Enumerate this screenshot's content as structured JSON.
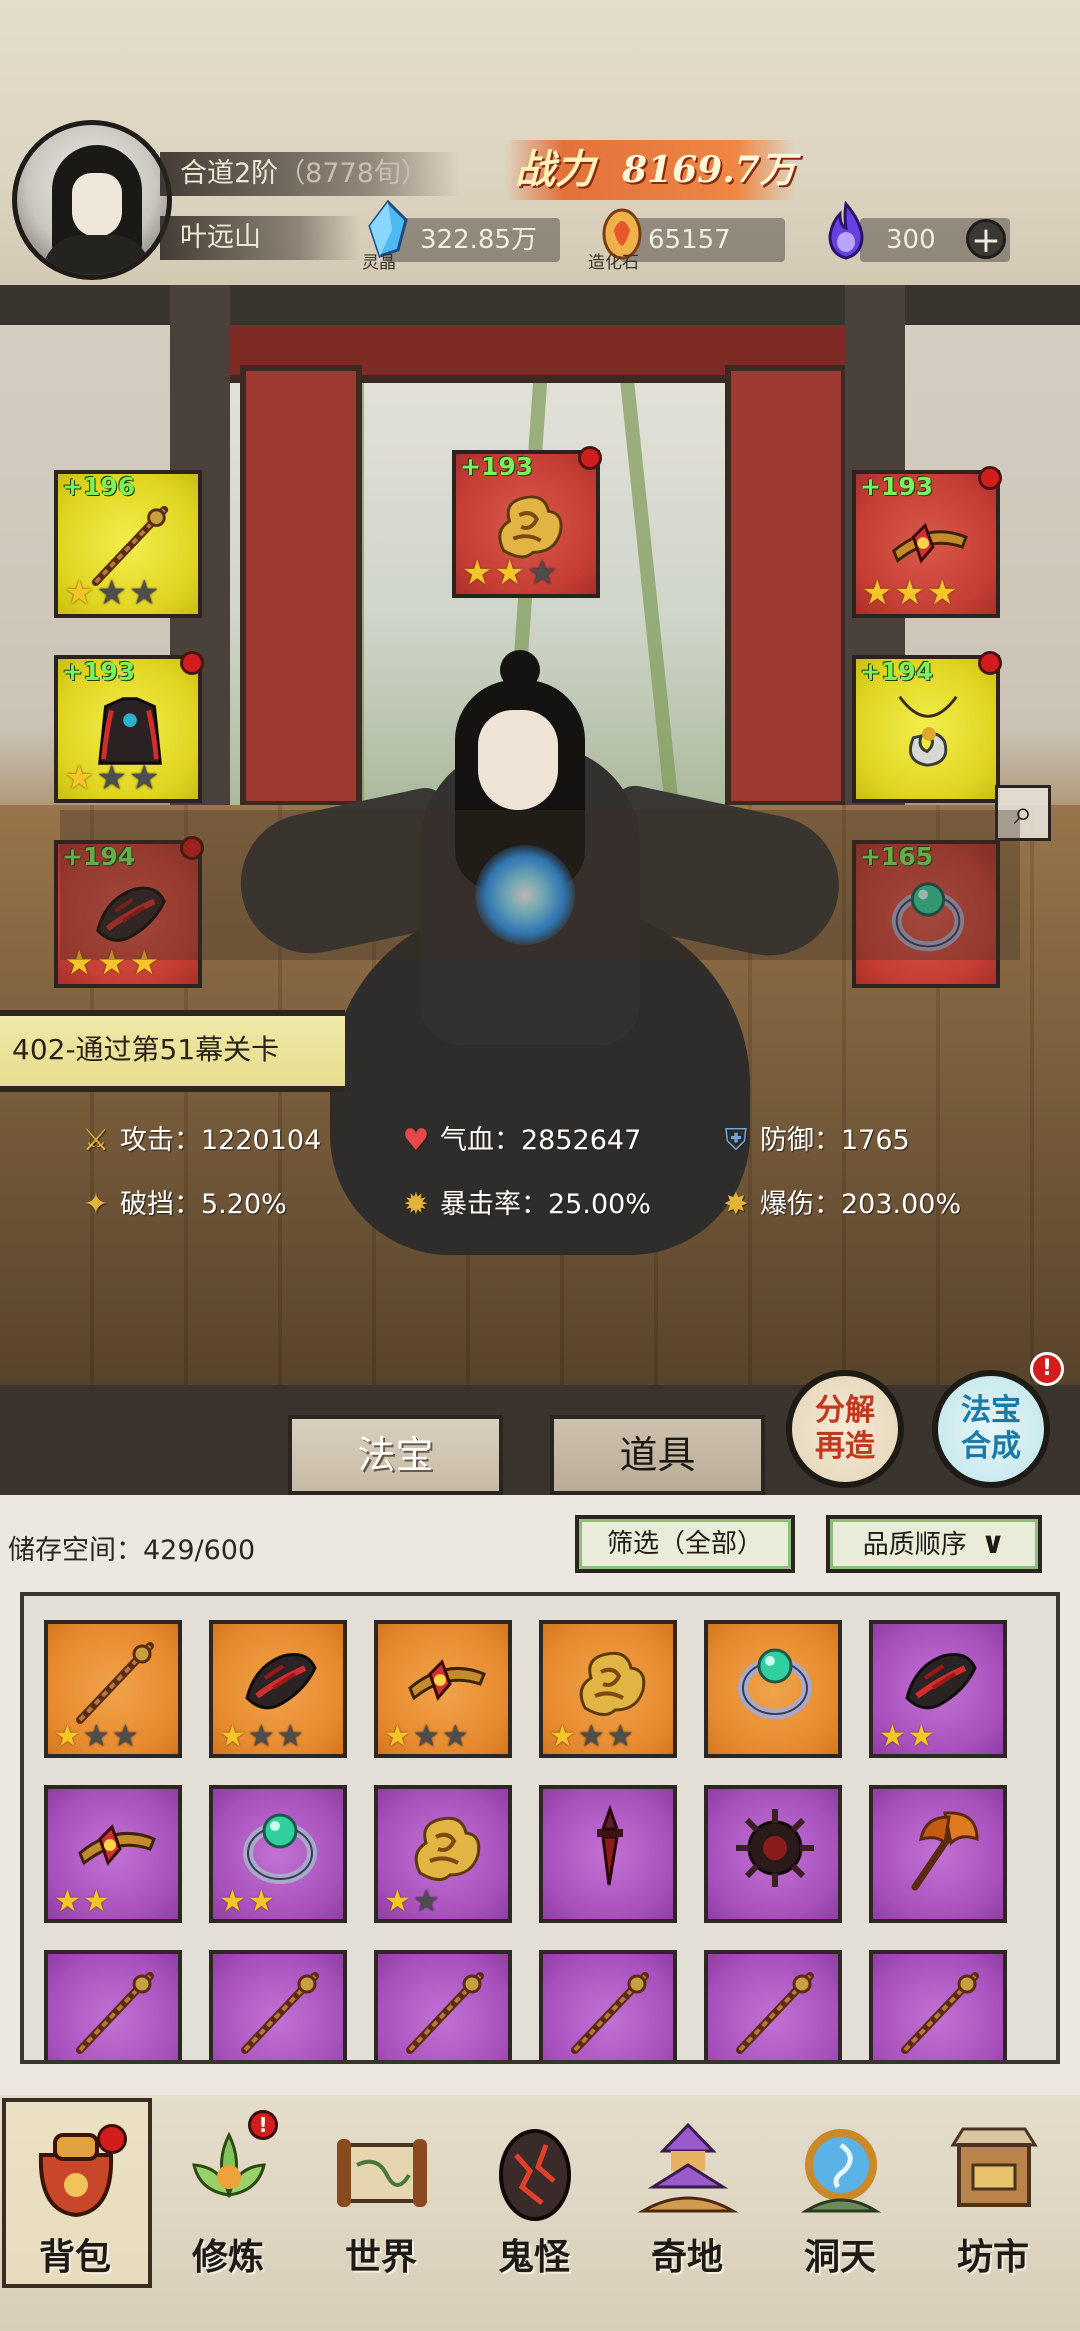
{
  "player": {
    "realm": "合道2阶",
    "realm_progress": "（8778旬）",
    "name": "叶远山",
    "power_label": "战力",
    "power_value": "8169.7万"
  },
  "resources": [
    {
      "icon": "blue-crystal-icon",
      "caption": "灵晶",
      "value": "322.85万"
    },
    {
      "icon": "fire-stone-icon",
      "caption": "造化石",
      "value": "65157"
    },
    {
      "icon": "purple-flame-icon",
      "caption": "",
      "value": "300"
    }
  ],
  "add_button": "+",
  "equipment": {
    "left": [
      {
        "level": "+196",
        "rarity": "yellow",
        "icon": "staff-icon",
        "stars": 1,
        "max_stars": 3,
        "badge": false
      },
      {
        "level": "+193",
        "rarity": "yellow",
        "icon": "robe-armor-icon",
        "stars": 1,
        "max_stars": 3,
        "badge": true
      },
      {
        "level": "+194",
        "rarity": "red",
        "icon": "gauntlet-icon",
        "stars": 3,
        "max_stars": 3,
        "badge": true
      }
    ],
    "center": {
      "level": "+193",
      "rarity": "red",
      "icon": "cloud-totem-icon",
      "stars": 2,
      "max_stars": 3,
      "badge": true
    },
    "right": [
      {
        "level": "+193",
        "rarity": "red",
        "icon": "headband-icon",
        "stars": 3,
        "max_stars": 3,
        "badge": true
      },
      {
        "level": "+194",
        "rarity": "yellow",
        "icon": "necklace-icon",
        "stars": 0,
        "max_stars": 0,
        "badge": true
      },
      {
        "level": "+165",
        "rarity": "red",
        "icon": "ring-icon",
        "stars": 0,
        "max_stars": 0,
        "badge": false
      }
    ]
  },
  "stats": [
    {
      "icon": "sword-icon",
      "label": "攻击：1220104"
    },
    {
      "icon": "heart-icon",
      "label": "气血：2852647"
    },
    {
      "icon": "shield-icon",
      "label": "防御：1765"
    },
    {
      "icon": "break-icon",
      "label": "破挡：5.20%"
    },
    {
      "icon": "crit-rate-icon",
      "label": "暴击率：25.00%"
    },
    {
      "icon": "crit-damage-icon",
      "label": "爆伤：203.00%"
    }
  ],
  "quest": "402-通过第51幕关卡",
  "actions": {
    "decompose": [
      "分解",
      "再造"
    ],
    "synthesize": [
      "法宝",
      "合成"
    ],
    "synth_badge": "!"
  },
  "tabs": {
    "treasure": "法宝",
    "items": "道具"
  },
  "inventory": {
    "storage_label": "储存空间：429/600",
    "filter_label": "筛选（全部）",
    "sort_label": "品质顺序",
    "cells": [
      {
        "rarity": "orange",
        "icon": "staff-icon",
        "stars": 1,
        "max_stars": 3
      },
      {
        "rarity": "orange",
        "icon": "gauntlet-icon",
        "stars": 1,
        "max_stars": 3
      },
      {
        "rarity": "orange",
        "icon": "headband-icon",
        "stars": 1,
        "max_stars": 3
      },
      {
        "rarity": "orange",
        "icon": "cloud-totem-icon",
        "stars": 1,
        "max_stars": 3
      },
      {
        "rarity": "orange",
        "icon": "ring-icon",
        "stars": 0,
        "max_stars": 0
      },
      {
        "rarity": "purple",
        "icon": "gauntlet-icon",
        "stars": 2,
        "max_stars": 2
      },
      {
        "rarity": "purple",
        "icon": "headband-icon",
        "stars": 2,
        "max_stars": 2
      },
      {
        "rarity": "purple",
        "icon": "ring-icon",
        "stars": 2,
        "max_stars": 2
      },
      {
        "rarity": "purple",
        "icon": "cloud-totem-icon",
        "stars": 1,
        "max_stars": 2
      },
      {
        "rarity": "purple",
        "icon": "dagger-icon",
        "stars": 0,
        "max_stars": 0
      },
      {
        "rarity": "purple",
        "icon": "spiked-wheel-icon",
        "stars": 0,
        "max_stars": 0
      },
      {
        "rarity": "purple",
        "icon": "axe-icon",
        "stars": 0,
        "max_stars": 0
      },
      {
        "rarity": "purple",
        "icon": "staff-icon",
        "stars": 0,
        "max_stars": 0
      },
      {
        "rarity": "purple",
        "icon": "staff-icon",
        "stars": 0,
        "max_stars": 0
      },
      {
        "rarity": "purple",
        "icon": "staff-icon",
        "stars": 0,
        "max_stars": 0
      },
      {
        "rarity": "purple",
        "icon": "staff-icon",
        "stars": 0,
        "max_stars": 0
      },
      {
        "rarity": "purple",
        "icon": "staff-icon",
        "stars": 0,
        "max_stars": 0
      },
      {
        "rarity": "purple",
        "icon": "staff-icon",
        "stars": 0,
        "max_stars": 0
      }
    ]
  },
  "bottom_nav": [
    {
      "label": "背包",
      "icon": "bag-icon",
      "badge": "",
      "active": true
    },
    {
      "label": "修炼",
      "icon": "lotus-icon",
      "badge": "!",
      "active": false
    },
    {
      "label": "世界",
      "icon": "scroll-map-icon",
      "badge": "",
      "active": false
    },
    {
      "label": "鬼怪",
      "icon": "demon-egg-icon",
      "badge": "",
      "active": false
    },
    {
      "label": "奇地",
      "icon": "pagoda-icon",
      "badge": "",
      "active": false
    },
    {
      "label": "洞天",
      "icon": "portal-icon",
      "badge": "",
      "active": false
    },
    {
      "label": "坊市",
      "icon": "market-stall-icon",
      "badge": "",
      "active": false
    }
  ],
  "colors": {
    "slot_yellow": "#e0d420",
    "slot_red": "#c63e34",
    "cell_orange": "#e7892e",
    "cell_purple": "#a850bd",
    "level_green": "#7cf25a",
    "power_orange": "#e26c34",
    "badge_red": "#d21d1d"
  }
}
